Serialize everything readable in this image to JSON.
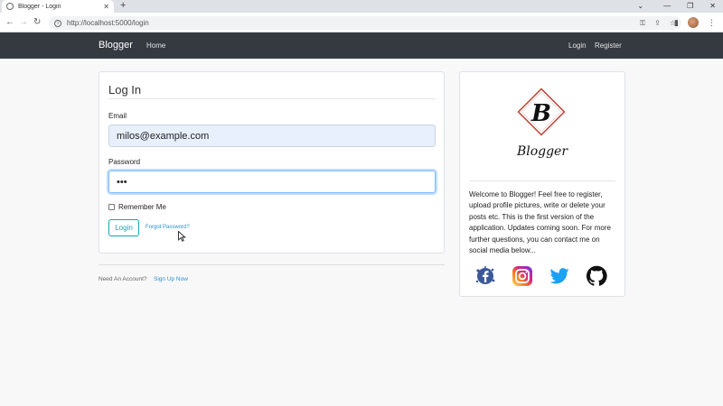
{
  "browser": {
    "tab_title": "Blogger - Login",
    "tab_close": "✕",
    "new_tab": "+",
    "url": "http://localhost:5000/login",
    "window_controls": {
      "minimize": "—",
      "restore": "❐",
      "close": "✕",
      "tabsearch": "⌄"
    },
    "nav": {
      "back": "←",
      "forward": "→",
      "reload": "↻"
    }
  },
  "navbar": {
    "brand": "Blogger",
    "home": "Home",
    "login": "Login",
    "register": "Register",
    "bg_color": "#343a40"
  },
  "login_form": {
    "legend": "Log In",
    "email_label": "Email",
    "email_value": "milos@example.com",
    "password_label": "Password",
    "password_value": "•••",
    "remember_label": "Remember Me",
    "submit_label": "Login",
    "forgot_label": "Forgot Password?",
    "accent_color": "#17a2b8"
  },
  "footer": {
    "need_account": "Need An Account?",
    "signup": "Sign Up Now"
  },
  "sidebar": {
    "logo_letter": "B",
    "logo_text": "Blogger",
    "about": "Welcome to Blogger! Feel free to register, upload profile pictures, write or delete your posts etc. This is the first version of the application. Updates coming soon. For more further questions, you can contact me on social media below...",
    "social": [
      "facebook-icon",
      "instagram-icon",
      "twitter-icon",
      "github-icon"
    ]
  }
}
